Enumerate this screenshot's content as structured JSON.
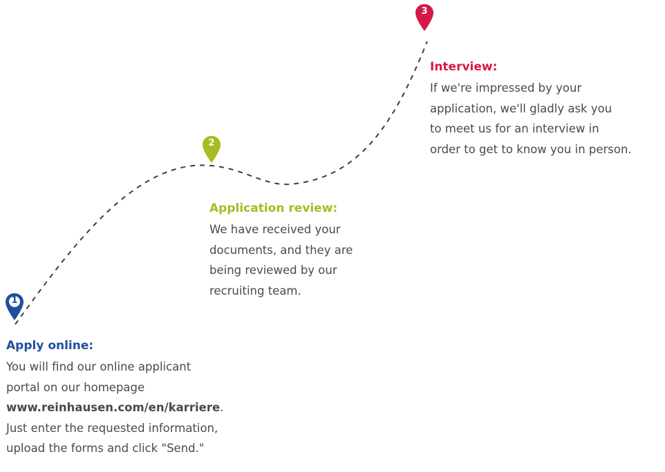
{
  "colors": {
    "step1": "#1e4f9b",
    "step2": "#a8bb22",
    "step3": "#d6174a",
    "path": "#3c3c3c",
    "text": "#4a4a4a"
  },
  "steps": [
    {
      "number": "1",
      "title": "Apply online:",
      "body_lines": [
        "You will find our online applicant",
        "portal on our homepage",
        "www.reinhausen.com/en/karriere",
        "Just enter the requested information,",
        "upload the forms and click \"Send.\""
      ],
      "link_suffix": "."
    },
    {
      "number": "2",
      "title": "Application review:",
      "body_lines": [
        "We have received your",
        "documents, and they are",
        "being reviewed by our",
        "recruiting team."
      ]
    },
    {
      "number": "3",
      "title": "Interview:",
      "body_lines": [
        "If we're impressed by your",
        "application, we'll gladly ask you",
        "to meet us for an interview in",
        "order to get to know you in person."
      ]
    }
  ]
}
